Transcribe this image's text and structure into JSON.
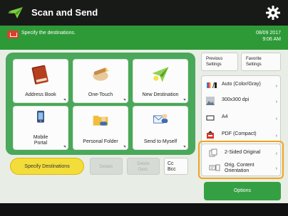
{
  "titlebar": {
    "title": "Scan and Send"
  },
  "statusbar": {
    "message": "Specify the destinations.",
    "date": "08/09 2017",
    "time": "9:06 AM"
  },
  "tiles": [
    {
      "label": "Address Book"
    },
    {
      "label": "One-Touch"
    },
    {
      "label": "New Destination"
    },
    {
      "label_line1": "Mobile",
      "label_line2": "Portal"
    },
    {
      "label": "Personal Folder"
    },
    {
      "label": "Send to Myself"
    }
  ],
  "actions": {
    "specify": "Specify Destinations",
    "details": "Details",
    "delete_line1": "Delete",
    "delete_line2": "Dest.",
    "cc_line1": "Cc",
    "cc_line2": "Bcc"
  },
  "right_top": {
    "previous_line1": "Previous",
    "previous_line2": "Settings",
    "favorite_line1": "Favorite",
    "favorite_line2": "Settings"
  },
  "settings": {
    "color": "Auto (Color/Gray)",
    "resolution": "300x300 dpi",
    "size": "A4",
    "format": "PDF (Compact)"
  },
  "orientation": {
    "two_sided": "2-Sided Original",
    "content_line1": "Orig. Content",
    "content_line2": "Orientation"
  },
  "options": {
    "label": "Options"
  },
  "colors": {
    "accent_green": "#2d9a37",
    "panel_green": "#4aa85a",
    "specify_yellow": "#f3dd3a",
    "highlight_orange": "#f2a51a"
  }
}
